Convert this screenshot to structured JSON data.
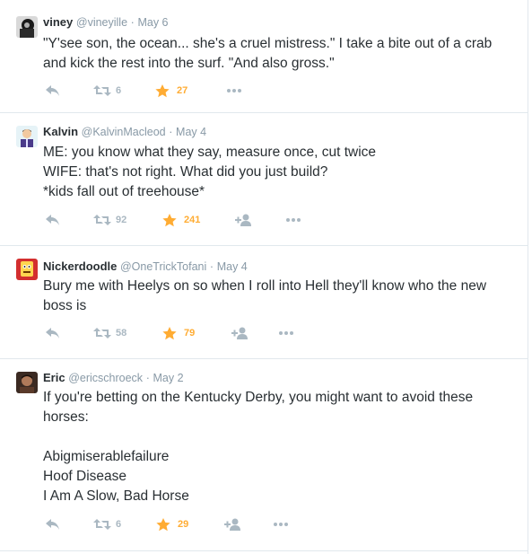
{
  "tweets": [
    {
      "fullname": "viney",
      "handle": "@vineyille",
      "separator": "·",
      "date": "May 6",
      "lines": [
        "\"Y'see son, the ocean... she's a cruel mistress.\" I take a bite out of a crab",
        "and kick the rest into the surf. \"And also gross.\""
      ],
      "retweets": "6",
      "likes": "27",
      "has_follow": false,
      "avatar_colors": [
        "#1a1a1a",
        "#b0b0b0"
      ]
    },
    {
      "fullname": "Kalvin",
      "handle": "@KalvinMacleod",
      "separator": "·",
      "date": "May 4",
      "lines": [
        "ME: you know what they say, measure once, cut twice",
        "WIFE: that's not right. What did you just build?",
        "*kids fall out of treehouse*"
      ],
      "retweets": "92",
      "likes": "241",
      "has_follow": true,
      "avatar_colors": [
        "#e6f3f7",
        "#4a3a8a"
      ]
    },
    {
      "fullname": "Nickerdoodle",
      "handle": "@OneTrickTofani",
      "separator": "·",
      "date": "May 4",
      "lines": [
        "Bury me with Heelys on so when I roll into Hell they'll know who the new",
        "boss is"
      ],
      "retweets": "58",
      "likes": "79",
      "has_follow": true,
      "avatar_colors": [
        "#d32f2f",
        "#ffd54f"
      ]
    },
    {
      "fullname": "Eric",
      "handle": "@ericschroeck",
      "separator": "·",
      "date": "May 2",
      "lines": [
        "If you're betting on the Kentucky Derby, you might want to avoid these",
        "horses:",
        "",
        "Abigmiserablefailure",
        "Hoof Disease",
        "I Am A Slow, Bad Horse"
      ],
      "retweets": "6",
      "likes": "29",
      "has_follow": true,
      "avatar_colors": [
        "#3b2a22",
        "#b07a5a"
      ]
    }
  ],
  "colors": {
    "icon_gray": "#aab8c2",
    "like_orange": "#ffac33",
    "name_text": "#292f33",
    "meta_text": "#8899a6",
    "divider": "#e1e8ed"
  },
  "icons": {
    "reply": "reply-icon",
    "retweet": "retweet-icon",
    "like": "star-icon",
    "follow": "follow-icon",
    "more": "more-icon"
  }
}
